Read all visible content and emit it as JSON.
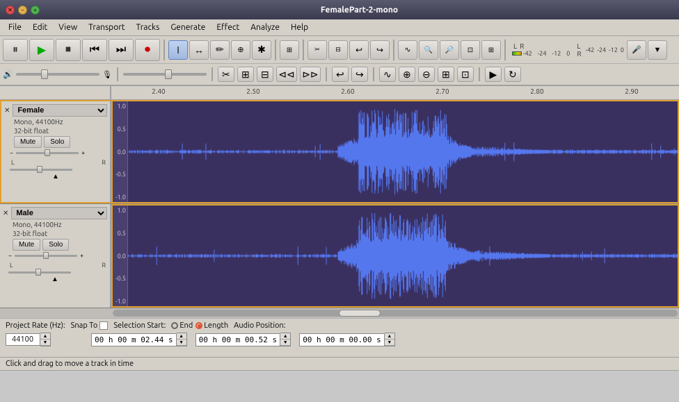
{
  "window": {
    "title": "FemalePart-2-mono",
    "buttons": [
      "close",
      "minimize",
      "maximize"
    ]
  },
  "menu": {
    "items": [
      "File",
      "Edit",
      "View",
      "Transport",
      "Tracks",
      "Generate",
      "Effect",
      "Analyze",
      "Help"
    ]
  },
  "toolbar": {
    "transport": {
      "pause_label": "⏸",
      "play_label": "▶",
      "stop_label": "⏹",
      "back_label": "⏮",
      "fwd_label": "⏭",
      "record_label": "⏺"
    },
    "tools": [
      "I",
      "↔",
      "✏",
      "⊕",
      "✱"
    ],
    "volume_label": "🔊",
    "db_values": [
      "-42",
      "-24",
      "-12",
      "0"
    ],
    "db_values2": [
      "-42",
      "-24",
      "-12",
      "0"
    ]
  },
  "ruler": {
    "ticks": [
      "2.40",
      "2.50",
      "2.60",
      "2.70",
      "2.80",
      "2.90"
    ]
  },
  "tracks": [
    {
      "id": "female-track",
      "name": "Female",
      "info_line1": "Mono, 44100Hz",
      "info_line2": "32-bit float",
      "mute_label": "Mute",
      "solo_label": "Solo",
      "selected": true,
      "y_labels": [
        "1.0",
        "0.5",
        "0.0",
        "-0.5",
        "-1.0"
      ]
    },
    {
      "id": "male-track",
      "name": "Male",
      "info_line1": "Mono, 44100Hz",
      "info_line2": "32-bit float",
      "mute_label": "Mute",
      "solo_label": "Solo",
      "selected": false,
      "y_labels": [
        "1.0",
        "0.5",
        "0.0",
        "-0.5",
        "-1.0"
      ]
    }
  ],
  "bottom_controls": {
    "project_rate_label": "Project Rate (Hz):",
    "project_rate_value": "44100",
    "snap_label": "Snap To",
    "selection_start_label": "Selection Start:",
    "end_label": "End",
    "length_label": "Length",
    "audio_position_label": "Audio Position:",
    "selection_start_value": "00 h 00 m 02.44 s",
    "length_value": "00 h 00 m 00.52 s",
    "audio_position_value": "00 h 00 m 00.00 s"
  },
  "status_bar": {
    "message": "Click and drag to move a track in time"
  }
}
